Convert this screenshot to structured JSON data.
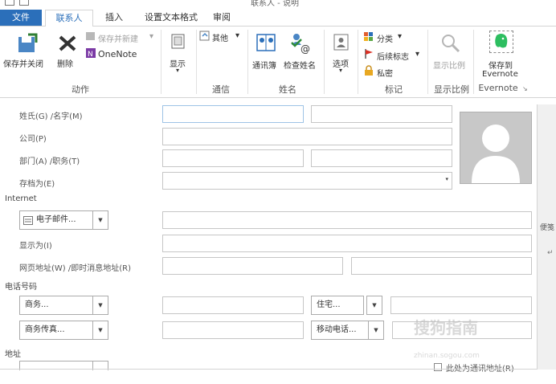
{
  "window": {
    "title": "联系人 - 说明"
  },
  "tabs": [
    "文件",
    "联系人",
    "插入",
    "设置文本格式",
    "审阅"
  ],
  "ribbon": {
    "actions": {
      "save_close": "保存并关闭",
      "delete": "删除",
      "save_new": "保存并新建",
      "onenote": "OneNote",
      "group": "动作"
    },
    "show": {
      "label": "显示"
    },
    "communicate": {
      "other": "其他",
      "group": "通信"
    },
    "names": {
      "address_book": "通讯簿",
      "check_names": "检查姓名",
      "group": "姓名"
    },
    "options": {
      "label": "选项"
    },
    "tags": {
      "categorize": "分类",
      "follow_up": "后续标志",
      "private": "私密",
      "group": "标记"
    },
    "zoom": {
      "label": "显示比例",
      "group": "显示比例"
    },
    "evernote": {
      "save_to": "保存到",
      "evernote": "Evernote",
      "group": "Evernote"
    }
  },
  "form": {
    "full_name": "姓氏(G) /名字(M)",
    "company": "公司(P)",
    "department": "部门(A) /职务(T)",
    "file_as": "存档为(E)",
    "internet": "Internet",
    "email_button": "电子邮件...",
    "display_as": "显示为(I)",
    "web_im": "网页地址(W) /即时消息地址(R)",
    "phone_numbers": "电话号码",
    "business": "商务...",
    "home": "住宅...",
    "business_fax": "商务传真...",
    "mobile": "移动电话...",
    "addresses": "地址",
    "mailing_address": "此处为通讯地址(R)",
    "right_pane_label": "便笺"
  },
  "watermark": {
    "main": "搜狗指南",
    "sub": "zhinan.sogou.com"
  },
  "colors": {
    "accent": "#2b6fba",
    "evernote": "#2dbe60"
  }
}
